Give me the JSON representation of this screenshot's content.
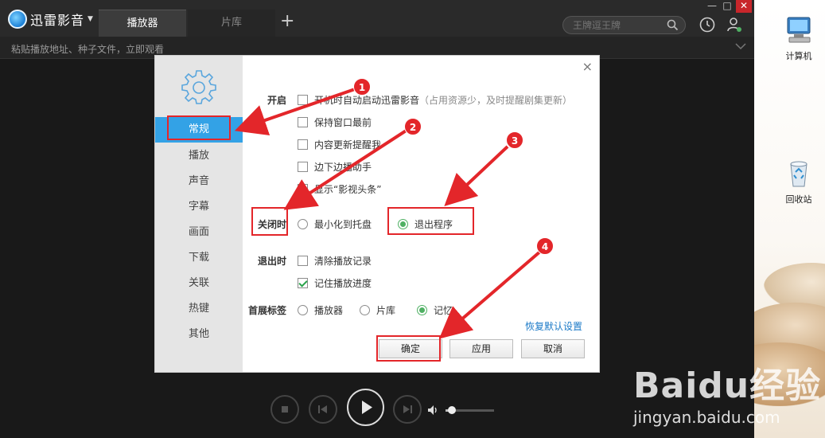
{
  "player": {
    "logo_text": "迅雷影音",
    "tabs": [
      {
        "label": "播放器"
      },
      {
        "label": "片库"
      }
    ],
    "search_placeholder": "王牌逗王牌",
    "url_placeholder": "粘贴播放地址、种子文件，立即观看"
  },
  "dialog": {
    "sidebar": [
      {
        "label": "常规"
      },
      {
        "label": "播放"
      },
      {
        "label": "声音"
      },
      {
        "label": "字幕"
      },
      {
        "label": "画面"
      },
      {
        "label": "下载"
      },
      {
        "label": "关联"
      },
      {
        "label": "热键"
      },
      {
        "label": "其他"
      }
    ],
    "startup": {
      "label": "开启",
      "options": [
        {
          "text": "开机时自动启动迅雷影音",
          "hint": "（占用资源少，及时提醒剧集更新）"
        },
        {
          "text": "保持窗口最前"
        },
        {
          "text": "内容更新提醒我"
        },
        {
          "text": "边下边播助手"
        },
        {
          "text": "显示“影视头条”"
        }
      ]
    },
    "on_close": {
      "label": "关闭时",
      "options": [
        "最小化到托盘",
        "退出程序"
      ]
    },
    "on_exit": {
      "label": "退出时",
      "options": [
        "清除播放记录",
        "记住播放进度"
      ]
    },
    "home_tab": {
      "label": "首展标签",
      "options": [
        "播放器",
        "片库",
        "记忆"
      ]
    },
    "restore_link": "恢复默认设置",
    "buttons": {
      "ok": "确定",
      "apply": "应用",
      "cancel": "取消"
    }
  },
  "annotations": [
    "1",
    "2",
    "3",
    "4"
  ],
  "desktop": [
    {
      "label": "计算机"
    },
    {
      "label": "回收站"
    }
  ],
  "watermark": {
    "main": "Baidu经验",
    "sub": "jingyan.baidu.com"
  },
  "colors": {
    "accent": "#33a2e6",
    "annotation": "#e3262a",
    "check": "#4fb063"
  }
}
